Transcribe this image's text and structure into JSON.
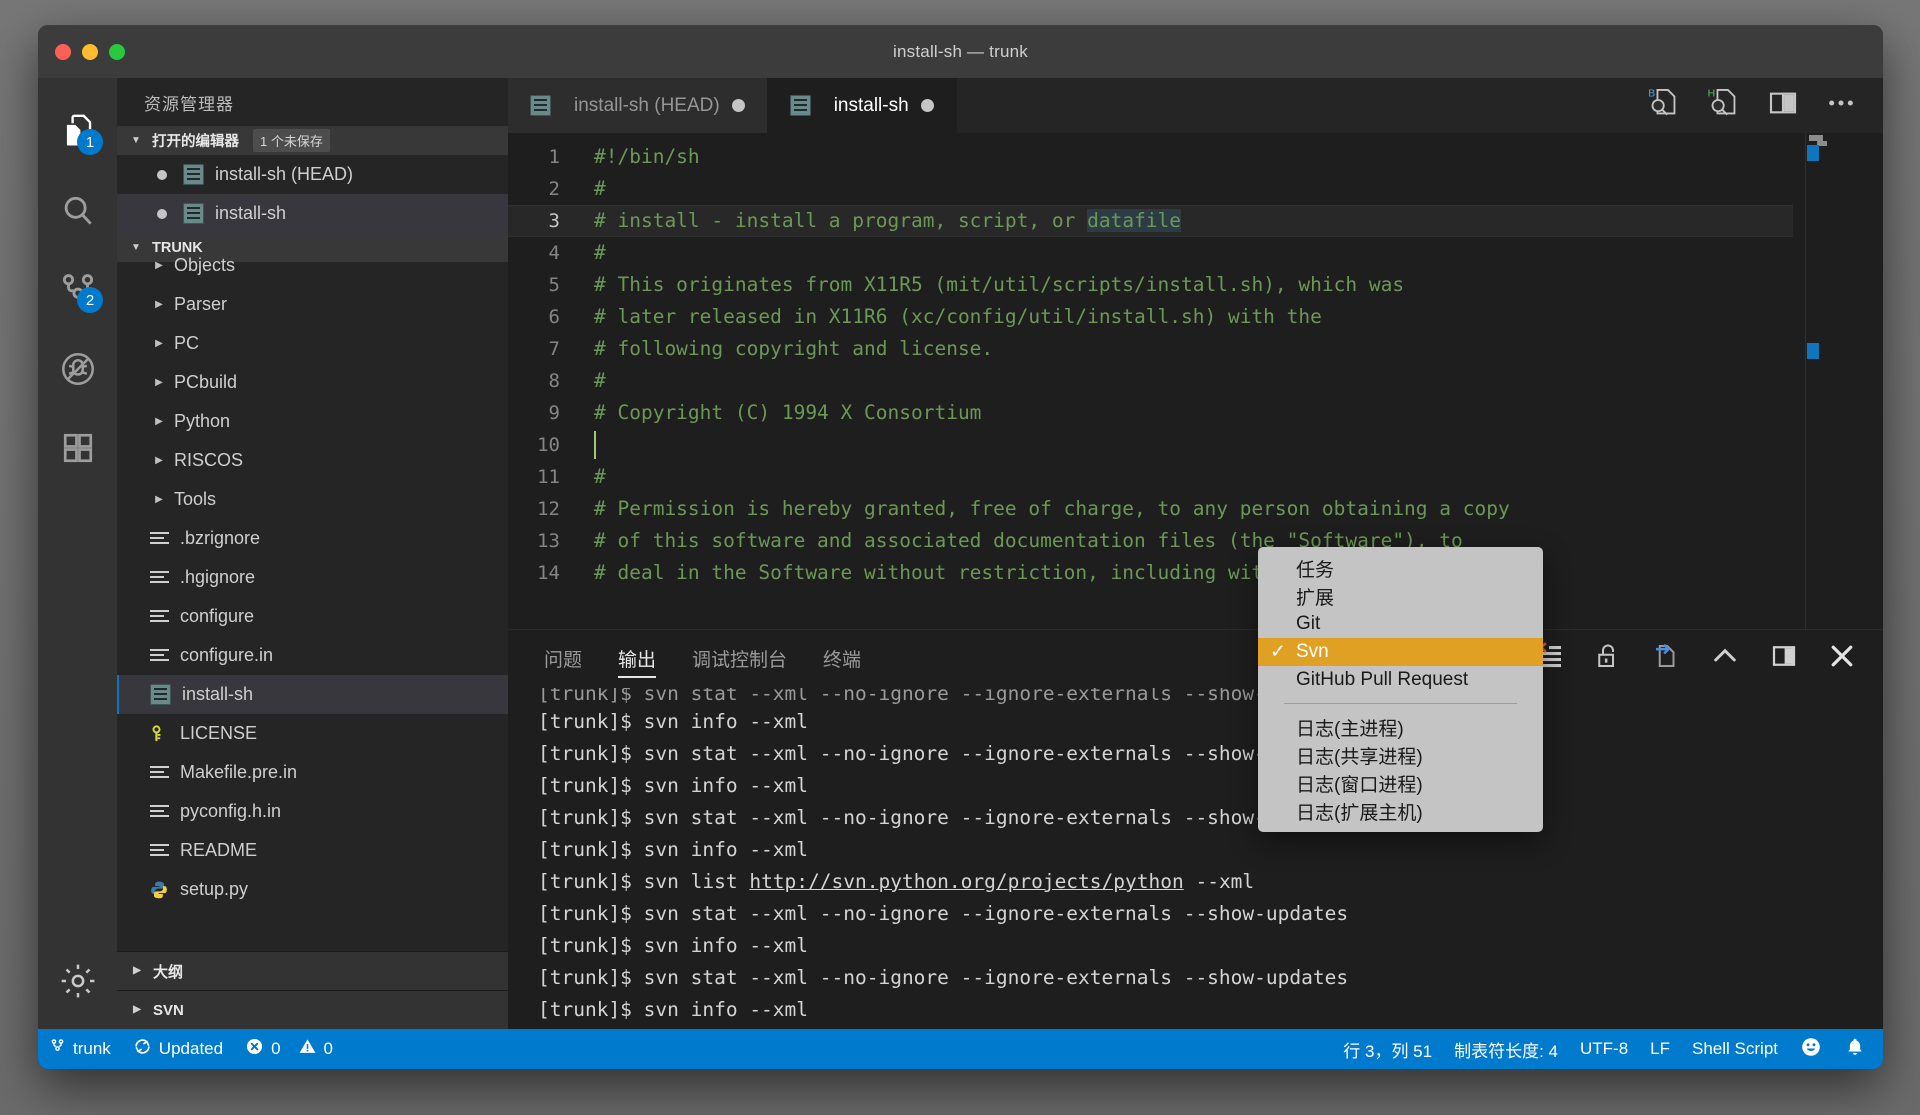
{
  "window": {
    "title": "install-sh — trunk",
    "traffic": [
      "close",
      "minimize",
      "maximize"
    ]
  },
  "activitybar": {
    "items": [
      {
        "name": "explorer",
        "icon": "files-icon",
        "badge": "1"
      },
      {
        "name": "search",
        "icon": "search-icon",
        "badge": ""
      },
      {
        "name": "source-control",
        "icon": "source-control-icon",
        "badge": "2"
      },
      {
        "name": "run-debug",
        "icon": "no-debug-icon",
        "badge": ""
      },
      {
        "name": "extensions",
        "icon": "extensions-icon",
        "badge": ""
      }
    ],
    "bottom": [
      {
        "name": "manage",
        "icon": "gear-icon"
      }
    ]
  },
  "sidebar": {
    "title": "资源管理器",
    "open_editors": {
      "label": "打开的编辑器",
      "unsaved_badge": "1 个未保存",
      "items": [
        {
          "label": "install-sh (HEAD)",
          "dirty": true,
          "selected": false
        },
        {
          "label": "install-sh",
          "dirty": true,
          "selected": true
        }
      ]
    },
    "workspace": {
      "label": "TRUNK",
      "items": [
        {
          "label": "Objects",
          "type": "folder",
          "selected": false
        },
        {
          "label": "Parser",
          "type": "folder",
          "selected": false
        },
        {
          "label": "PC",
          "type": "folder",
          "selected": false
        },
        {
          "label": "PCbuild",
          "type": "folder",
          "selected": false
        },
        {
          "label": "Python",
          "type": "folder",
          "selected": false
        },
        {
          "label": "RISCOS",
          "type": "folder",
          "selected": false
        },
        {
          "label": "Tools",
          "type": "folder",
          "selected": false
        },
        {
          "label": ".bzrignore",
          "type": "file",
          "selected": false
        },
        {
          "label": ".hgignore",
          "type": "file",
          "selected": false
        },
        {
          "label": "configure",
          "type": "file",
          "selected": false
        },
        {
          "label": "configure.in",
          "type": "file",
          "selected": false
        },
        {
          "label": "install-sh",
          "type": "shell",
          "selected": true
        },
        {
          "label": "LICENSE",
          "type": "license",
          "selected": false
        },
        {
          "label": "Makefile.pre.in",
          "type": "file",
          "selected": false
        },
        {
          "label": "pyconfig.h.in",
          "type": "file",
          "selected": false
        },
        {
          "label": "README",
          "type": "file",
          "selected": false
        },
        {
          "label": "setup.py",
          "type": "python",
          "selected": false
        }
      ]
    },
    "footer_sections": [
      {
        "label": "大纲"
      },
      {
        "label": "SVN"
      }
    ]
  },
  "editor": {
    "tabs": [
      {
        "label": "install-sh (HEAD)",
        "active": false,
        "dirty": true
      },
      {
        "label": "install-sh",
        "active": true,
        "dirty": true
      }
    ],
    "actions": [
      {
        "name": "compare-with-base-icon",
        "letter": "B",
        "color": "#4ea1e0"
      },
      {
        "name": "compare-with-head-icon",
        "letter": "H",
        "color": "#4ec94e"
      },
      {
        "name": "split-editor-icon"
      },
      {
        "name": "more-actions-icon"
      }
    ],
    "lines": [
      {
        "no": "1",
        "text": "#!/bin/sh"
      },
      {
        "no": "2",
        "text": "#"
      },
      {
        "no": "3",
        "text": "# install - install a program, script, or datafile",
        "current": true,
        "selection": "datafile"
      },
      {
        "no": "4",
        "text": "#"
      },
      {
        "no": "5",
        "text": "# This originates from X11R5 (mit/util/scripts/install.sh), which was"
      },
      {
        "no": "6",
        "text": "# later released in X11R6 (xc/config/util/install.sh) with the"
      },
      {
        "no": "7",
        "text": "# following copyright and license."
      },
      {
        "no": "8",
        "text": "#"
      },
      {
        "no": "9",
        "text": "# Copyright (C) 1994 X Consortium"
      },
      {
        "no": "10",
        "text": "",
        "caret": true
      },
      {
        "no": "11",
        "text": "#"
      },
      {
        "no": "12",
        "text": "# Permission is hereby granted, free of charge, to any person obtaining a copy"
      },
      {
        "no": "13",
        "text": "# of this software and associated documentation files (the \"Software\"), to"
      },
      {
        "no": "14",
        "text": "# deal in the Software without restriction, including without limitation the"
      }
    ]
  },
  "panel": {
    "tabs": [
      {
        "label": "问题",
        "active": false
      },
      {
        "label": "输出",
        "active": true
      },
      {
        "label": "调试控制台",
        "active": false
      },
      {
        "label": "终端",
        "active": false
      }
    ],
    "actions": [
      {
        "name": "output-channel-select"
      },
      {
        "name": "clear-output-icon"
      },
      {
        "name": "unlock-scroll-icon"
      },
      {
        "name": "open-in-editor-icon"
      },
      {
        "name": "maximize-panel-icon"
      },
      {
        "name": "split-panel-icon"
      },
      {
        "name": "close-panel-icon"
      }
    ],
    "output_lines": [
      {
        "text": "[trunk]$ svn stat --xml --no-ignore --ignore-externals --show-updates",
        "partial": true
      },
      {
        "text": "[trunk]$ svn info --xml"
      },
      {
        "text": "[trunk]$ svn stat --xml --no-ignore --ignore-externals --show-updates"
      },
      {
        "text": "[trunk]$ svn info --xml"
      },
      {
        "text": "[trunk]$ svn stat --xml --no-ignore --ignore-externals --show-updates"
      },
      {
        "text": "[trunk]$ svn info --xml"
      },
      {
        "prefix": "[trunk]$ svn list ",
        "link": "http://svn.python.org/projects/python",
        "suffix": " --xml"
      },
      {
        "text": "[trunk]$ svn stat --xml --no-ignore --ignore-externals --show-updates"
      },
      {
        "text": "[trunk]$ svn info --xml"
      },
      {
        "text": "[trunk]$ svn stat --xml --no-ignore --ignore-externals --show-updates"
      },
      {
        "text": "[trunk]$ svn info --xml"
      }
    ]
  },
  "menu": {
    "items": [
      {
        "label": "任务",
        "checked": false
      },
      {
        "label": "扩展",
        "checked": false
      },
      {
        "label": "Git",
        "checked": false
      },
      {
        "label": "Svn",
        "checked": true
      },
      {
        "label": "GitHub Pull Request",
        "checked": false
      }
    ],
    "items2": [
      {
        "label": "日志(主进程)"
      },
      {
        "label": "日志(共享进程)"
      },
      {
        "label": "日志(窗口进程)"
      },
      {
        "label": "日志(扩展主机)"
      }
    ],
    "check_glyph": "✓"
  },
  "statusbar": {
    "background": "#007acc",
    "left": [
      {
        "name": "branch",
        "icon": "source-control-icon",
        "label": "trunk"
      },
      {
        "name": "sync",
        "icon": "sync-icon",
        "label": "Updated"
      },
      {
        "name": "errors",
        "icon": "error-icon",
        "label": "0"
      },
      {
        "name": "warnings",
        "icon": "warning-icon",
        "label": "0"
      }
    ],
    "right": [
      {
        "name": "cursor-position",
        "label": "行 3，列 51"
      },
      {
        "name": "indentation",
        "label": "制表符长度: 4"
      },
      {
        "name": "encoding",
        "label": "UTF-8"
      },
      {
        "name": "eol",
        "label": "LF"
      },
      {
        "name": "language-mode",
        "label": "Shell Script"
      },
      {
        "name": "feedback-smiley",
        "icon": "smiley-icon",
        "label": ""
      },
      {
        "name": "notifications",
        "icon": "bell-icon",
        "label": ""
      }
    ]
  }
}
